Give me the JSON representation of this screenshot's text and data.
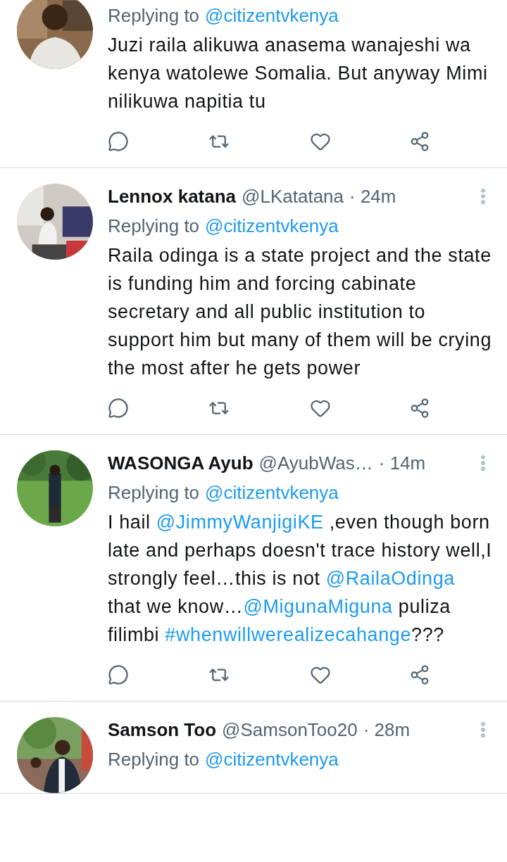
{
  "tweets": [
    {
      "replying_label": "Replying to",
      "replying_handle": "@citizentvkenya",
      "body": [
        {
          "kind": "text",
          "text": "Juzi raila alikuwa anasema wanajeshi wa kenya watolewe Somalia. But anyway Mimi nilikuwa napitia tu"
        }
      ]
    },
    {
      "name": "Lennox katana",
      "handle": "@LKatatana",
      "time": "· 24m",
      "replying_label": "Replying to",
      "replying_handle": "@citizentvkenya",
      "body": [
        {
          "kind": "text",
          "text": "Raila odinga is a state project and the state is funding him and forcing cabinate secretary and all public institution to support him but many of them will be crying the most after he gets power"
        }
      ]
    },
    {
      "name": "WASONGA Ayub",
      "handle": "@AyubWas…",
      "time": "· 14m",
      "replying_label": "Replying to",
      "replying_handle": "@citizentvkenya",
      "body": [
        {
          "kind": "text",
          "text": "I hail "
        },
        {
          "kind": "mention",
          "text": "@JimmyWanjigiKE"
        },
        {
          "kind": "text",
          "text": " ,even though born late and perhaps doesn't trace history well,I strongly feel…this is not "
        },
        {
          "kind": "mention",
          "text": "@RailaOdinga"
        },
        {
          "kind": "text",
          "text": " that we know…"
        },
        {
          "kind": "mention",
          "text": "@MigunaMiguna"
        },
        {
          "kind": "text",
          "text": " puliza filimbi "
        },
        {
          "kind": "hashtag",
          "text": "#whenwillwerealizecahange"
        },
        {
          "kind": "text",
          "text": "???"
        }
      ]
    },
    {
      "name": "Samson Too",
      "handle": "@SamsonToo20",
      "time": "· 28m",
      "replying_label": "Replying to",
      "replying_handle": "@citizentvkenya"
    }
  ]
}
